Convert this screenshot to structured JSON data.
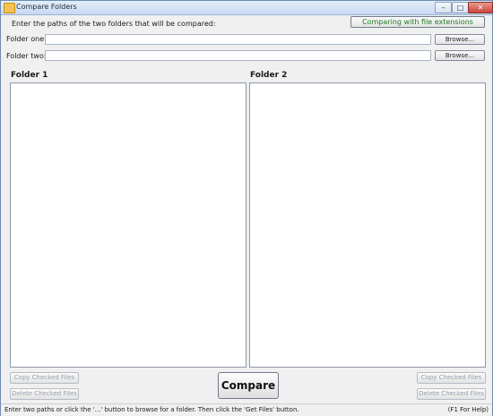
{
  "window": {
    "title": "Compare Folders",
    "controls": {
      "minimize": "–",
      "maximize": "□",
      "close": "✕"
    }
  },
  "header": {
    "instruction": "Enter the paths of the two folders that will be compared:",
    "mode_badge": "Comparing with file extensions"
  },
  "folders": {
    "one_label": "Folder one:",
    "two_label": "Folder two:",
    "one_value": "",
    "two_value": "",
    "browse_label": "Browse..."
  },
  "panels": {
    "left_title": "Folder 1",
    "right_title": "Folder 2"
  },
  "actions": {
    "copy_checked": "Copy Checked Files",
    "delete_checked": "Delete Checked Files",
    "compare": "Compare"
  },
  "status": {
    "message": "Enter two paths or click the '...' button to browse for a folder. Then click the 'Get Files' button.",
    "help": "(F1 For Help)"
  },
  "colors": {
    "badge_text": "#1e7a28",
    "background": "#f0f0f0"
  }
}
